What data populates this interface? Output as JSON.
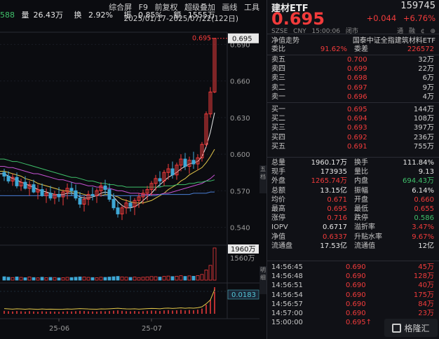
{
  "topbar": {
    "left_fragment": "588",
    "vol_label": "量",
    "vol": "26.43万",
    "turnover_label": "换",
    "turnover": "2.92%",
    "amplitude_label": "振",
    "amplitude": "0.85%",
    "amount_label": "额",
    "amount": "1555万",
    "menu": [
      "综合屏",
      "F9",
      "前复权",
      "超级叠加",
      "画线",
      "工具"
    ],
    "range": "2025/01/17-2025/07/22(122日)"
  },
  "chart_axes": {
    "price_ticks": [
      "0.690",
      "0.660",
      "0.630",
      "0.600",
      "0.570",
      "0.540"
    ],
    "last_price_tag": "0.695",
    "last_price_marker": "0.695",
    "volume_tag": "1960万",
    "volume_tick": "1560万",
    "indicator_tag": "0.0183",
    "date_labels": [
      "25-06",
      "25-07"
    ]
  },
  "chart_data": {
    "type": "candlestick",
    "title": "",
    "y_range": [
      0.53,
      0.7
    ],
    "candles": [
      [
        0.585,
        0.588,
        0.578,
        0.582
      ],
      [
        0.582,
        0.586,
        0.576,
        0.578
      ],
      [
        0.578,
        0.584,
        0.574,
        0.581
      ],
      [
        0.581,
        0.585,
        0.572,
        0.574
      ],
      [
        0.574,
        0.58,
        0.57,
        0.577
      ],
      [
        0.577,
        0.582,
        0.571,
        0.572
      ],
      [
        0.572,
        0.578,
        0.566,
        0.575
      ],
      [
        0.575,
        0.579,
        0.568,
        0.569
      ],
      [
        0.569,
        0.575,
        0.563,
        0.571
      ],
      [
        0.571,
        0.576,
        0.565,
        0.566
      ],
      [
        0.566,
        0.572,
        0.56,
        0.568
      ],
      [
        0.568,
        0.574,
        0.562,
        0.564
      ],
      [
        0.564,
        0.57,
        0.559,
        0.567
      ],
      [
        0.567,
        0.573,
        0.561,
        0.565
      ],
      [
        0.565,
        0.571,
        0.558,
        0.569
      ],
      [
        0.569,
        0.576,
        0.563,
        0.572
      ],
      [
        0.572,
        0.577,
        0.566,
        0.57
      ],
      [
        0.57,
        0.575,
        0.562,
        0.564
      ],
      [
        0.564,
        0.569,
        0.556,
        0.559
      ],
      [
        0.559,
        0.566,
        0.553,
        0.563
      ],
      [
        0.563,
        0.57,
        0.558,
        0.567
      ],
      [
        0.567,
        0.573,
        0.562,
        0.566
      ],
      [
        0.566,
        0.572,
        0.56,
        0.57
      ],
      [
        0.57,
        0.577,
        0.565,
        0.574
      ],
      [
        0.574,
        0.579,
        0.567,
        0.571
      ],
      [
        0.571,
        0.576,
        0.561,
        0.563
      ],
      [
        0.563,
        0.568,
        0.554,
        0.556
      ],
      [
        0.556,
        0.561,
        0.548,
        0.551
      ],
      [
        0.551,
        0.558,
        0.546,
        0.556
      ],
      [
        0.556,
        0.563,
        0.551,
        0.56
      ],
      [
        0.56,
        0.566,
        0.553,
        0.557
      ],
      [
        0.557,
        0.564,
        0.55,
        0.562
      ],
      [
        0.562,
        0.568,
        0.556,
        0.565
      ],
      [
        0.565,
        0.571,
        0.559,
        0.568
      ],
      [
        0.568,
        0.574,
        0.562,
        0.571
      ],
      [
        0.571,
        0.578,
        0.566,
        0.576
      ],
      [
        0.576,
        0.583,
        0.57,
        0.58
      ],
      [
        0.58,
        0.586,
        0.573,
        0.578
      ],
      [
        0.578,
        0.587,
        0.574,
        0.585
      ],
      [
        0.585,
        0.592,
        0.579,
        0.588
      ],
      [
        0.588,
        0.594,
        0.58,
        0.583
      ],
      [
        0.583,
        0.593,
        0.579,
        0.591
      ],
      [
        0.591,
        0.6,
        0.586,
        0.596
      ],
      [
        0.596,
        0.601,
        0.587,
        0.59
      ],
      [
        0.59,
        0.598,
        0.584,
        0.595
      ],
      [
        0.595,
        0.602,
        0.588,
        0.592
      ],
      [
        0.592,
        0.6,
        0.587,
        0.597
      ],
      [
        0.597,
        0.61,
        0.594,
        0.608
      ],
      [
        0.608,
        0.635,
        0.606,
        0.633
      ],
      [
        0.633,
        0.655,
        0.63,
        0.651
      ],
      [
        0.651,
        0.695,
        0.65,
        0.695
      ]
    ],
    "moving_averages": [
      {
        "color": "#e8e8e8",
        "values": [
          0.584,
          0.582,
          0.58,
          0.579,
          0.577,
          0.576,
          0.574,
          0.573,
          0.571,
          0.57,
          0.569,
          0.568,
          0.567,
          0.567,
          0.567,
          0.568,
          0.568,
          0.567,
          0.565,
          0.564,
          0.564,
          0.565,
          0.566,
          0.568,
          0.569,
          0.568,
          0.565,
          0.561,
          0.558,
          0.556,
          0.556,
          0.557,
          0.559,
          0.562,
          0.565,
          0.568,
          0.572,
          0.575,
          0.578,
          0.581,
          0.583,
          0.585,
          0.588,
          0.59,
          0.592,
          0.593,
          0.594,
          0.598,
          0.606,
          0.618,
          0.634
        ]
      },
      {
        "color": "#e3c74a",
        "values": [
          0.586,
          0.585,
          0.584,
          0.583,
          0.582,
          0.58,
          0.579,
          0.578,
          0.576,
          0.575,
          0.574,
          0.573,
          0.572,
          0.571,
          0.57,
          0.57,
          0.569,
          0.569,
          0.568,
          0.567,
          0.566,
          0.566,
          0.566,
          0.566,
          0.567,
          0.567,
          0.566,
          0.565,
          0.563,
          0.562,
          0.561,
          0.56,
          0.56,
          0.56,
          0.561,
          0.562,
          0.564,
          0.566,
          0.568,
          0.571,
          0.573,
          0.575,
          0.578,
          0.58,
          0.583,
          0.585,
          0.587,
          0.589,
          0.593,
          0.598,
          0.604
        ]
      },
      {
        "color": "#c653d3",
        "values": [
          0.59,
          0.589,
          0.589,
          0.588,
          0.587,
          0.586,
          0.585,
          0.584,
          0.584,
          0.583,
          0.582,
          0.581,
          0.58,
          0.579,
          0.579,
          0.578,
          0.577,
          0.576,
          0.576,
          0.575,
          0.574,
          0.574,
          0.573,
          0.573,
          0.572,
          0.572,
          0.571,
          0.57,
          0.57,
          0.569,
          0.568,
          0.568,
          0.568,
          0.567,
          0.567,
          0.567,
          0.567,
          0.567,
          0.568,
          0.568,
          0.569,
          0.57,
          0.571,
          0.572,
          0.573,
          0.574,
          0.575,
          0.576,
          0.578,
          0.58,
          0.583
        ]
      },
      {
        "color": "#3fc06a",
        "values": [
          0.596,
          0.595,
          0.594,
          0.594,
          0.593,
          0.592,
          0.591,
          0.59,
          0.589,
          0.588,
          0.587,
          0.586,
          0.585,
          0.584,
          0.583,
          0.582,
          0.581,
          0.581,
          0.58,
          0.579,
          0.578,
          0.578,
          0.577,
          0.576,
          0.576,
          0.575,
          0.575,
          0.574,
          0.574,
          0.573,
          0.573,
          0.573,
          0.573,
          0.573,
          0.573,
          0.573,
          0.573,
          0.573,
          0.574,
          0.574,
          0.574,
          0.575,
          0.575,
          0.575,
          0.576,
          0.576,
          0.577,
          0.577,
          0.578,
          0.578,
          0.579
        ]
      },
      {
        "color": "#4a7fd6",
        "values": [
          0.566,
          0.566,
          0.566,
          0.566,
          0.566,
          0.566,
          0.566,
          0.566,
          0.566,
          0.566,
          0.566,
          0.566,
          0.566,
          0.566,
          0.566,
          0.566,
          0.566,
          0.566,
          0.566,
          0.566,
          0.566,
          0.566,
          0.566,
          0.566,
          0.566,
          0.566,
          0.566,
          0.566,
          0.566,
          0.566,
          0.566,
          0.566,
          0.566,
          0.566,
          0.566,
          0.566,
          0.566,
          0.567,
          0.567,
          0.567,
          0.567,
          0.567,
          0.567,
          0.567,
          0.567,
          0.568,
          0.568,
          0.568,
          0.568,
          0.569,
          0.569
        ]
      }
    ],
    "volume": [
      210,
      180,
      160,
      200,
      170,
      150,
      190,
      160,
      140,
      180,
      150,
      170,
      160,
      140,
      150,
      170,
      160,
      180,
      200,
      190,
      170,
      160,
      150,
      180,
      170,
      190,
      210,
      230,
      200,
      180,
      170,
      190,
      160,
      180,
      200,
      220,
      210,
      190,
      230,
      250,
      220,
      240,
      270,
      230,
      260,
      240,
      280,
      350,
      620,
      900,
      1960
    ],
    "volume_ylim": [
      0,
      1960
    ],
    "indicator": [
      0.002,
      0.0018,
      0.0016,
      0.0019,
      0.0017,
      0.0015,
      0.0018,
      0.0016,
      0.0014,
      0.0017,
      0.0015,
      0.0016,
      0.0015,
      0.0014,
      0.0015,
      0.0017,
      0.0016,
      0.0018,
      0.002,
      0.0019,
      0.0017,
      0.0016,
      0.0015,
      0.0018,
      0.0017,
      0.0019,
      0.0021,
      0.0023,
      0.002,
      0.0018,
      0.0017,
      0.0019,
      0.0016,
      0.0018,
      0.002,
      0.0022,
      0.0021,
      0.0019,
      0.0023,
      0.0025,
      0.0022,
      0.0024,
      0.0027,
      0.0023,
      0.0026,
      0.0024,
      0.0028,
      0.0036,
      0.0062,
      0.0095,
      0.0183
    ],
    "indicator_ylim": [
      0,
      0.0183
    ]
  },
  "quote": {
    "name": "建材ETF",
    "code": "159745",
    "price": "0.695",
    "change": "+0.044",
    "change_pct": "+6.76%",
    "meta_left": [
      "SZSE",
      "CNY",
      "15:00:06",
      "闭市"
    ],
    "meta_right": [
      "通",
      "融",
      "¢",
      "⊕"
    ],
    "val_label": "净值走势",
    "fund_full_name": "国泰中证全指建筑材料ETF",
    "weibi_label": "委比",
    "weibi": "91.62%",
    "weicha_label": "委差",
    "weicha": "226572",
    "asks": [
      {
        "label": "卖五",
        "price": "0.700",
        "vol": "32万"
      },
      {
        "label": "卖四",
        "price": "0.699",
        "vol": "22万"
      },
      {
        "label": "卖三",
        "price": "0.698",
        "vol": "6万"
      },
      {
        "label": "卖二",
        "price": "0.697",
        "vol": "9万"
      },
      {
        "label": "卖一",
        "price": "0.696",
        "vol": "4万"
      }
    ],
    "bids": [
      {
        "label": "买一",
        "price": "0.695",
        "vol": "144万"
      },
      {
        "label": "买二",
        "price": "0.694",
        "vol": "108万"
      },
      {
        "label": "买三",
        "price": "0.693",
        "vol": "397万"
      },
      {
        "label": "买四",
        "price": "0.692",
        "vol": "236万"
      },
      {
        "label": "买五",
        "price": "0.691",
        "vol": "755万"
      }
    ],
    "stats": [
      {
        "k1": "总量",
        "v1": "1960.17万",
        "c1": "#e8e8e8",
        "k2": "换手",
        "v2": "111.84%",
        "c2": "#e8e8e8"
      },
      {
        "k1": "现手",
        "v1": "173935",
        "c1": "#e8e8e8",
        "k2": "量比",
        "v2": "9.13",
        "c2": "#e8e8e8"
      },
      {
        "k1": "外盘",
        "v1": "1265.74万",
        "c1": "#f23b3b",
        "k2": "内盘",
        "v2": "694.43万",
        "c2": "#3fc06a"
      },
      {
        "k1": "总额",
        "v1": "13.15亿",
        "c1": "#e8e8e8",
        "k2": "振幅",
        "v2": "6.14%",
        "c2": "#e8e8e8"
      },
      {
        "k1": "均价",
        "v1": "0.671",
        "c1": "#f23b3b",
        "k2": "开盘",
        "v2": "0.660",
        "c2": "#f23b3b"
      },
      {
        "k1": "最高",
        "v1": "0.695",
        "c1": "#f23b3b",
        "k2": "最低",
        "v2": "0.655",
        "c2": "#f23b3b"
      },
      {
        "k1": "涨停",
        "v1": "0.716",
        "c1": "#f23b3b",
        "k2": "跌停",
        "v2": "0.586",
        "c2": "#3fc06a"
      },
      {
        "k1": "IOPV",
        "v1": "0.6717",
        "c1": "#e8e8e8",
        "k2": "溢折率",
        "v2": "3.47%",
        "c2": "#f23b3b"
      },
      {
        "k1": "净值",
        "v1": "0.6337",
        "c1": "#f23b3b",
        "k2": "升贴水率",
        "v2": "9.67%",
        "c2": "#f23b3b"
      },
      {
        "k1": "流通盘",
        "v1": "17.53亿",
        "c1": "#e8e8e8",
        "k2": "流通值",
        "v2": "12亿",
        "c2": "#e8e8e8"
      }
    ],
    "ticks": [
      {
        "t": "14:56:45",
        "p": "0.690",
        "v": "45万"
      },
      {
        "t": "14:56:48",
        "p": "0.690",
        "v": "128万"
      },
      {
        "t": "14:56:51",
        "p": "0.690",
        "v": "40万"
      },
      {
        "t": "14:56:54",
        "p": "0.690",
        "v": "175万"
      },
      {
        "t": "14:56:57",
        "p": "0.690",
        "v": "84万"
      },
      {
        "t": "14:57:00",
        "p": "0.690",
        "v": "23万"
      },
      {
        "t": "15:00:00",
        "p": "0.695",
        "v": ""
      }
    ],
    "tick_arrow": "↑",
    "logo_text": "格隆汇"
  },
  "side_tabs": [
    "五",
    "档",
    "明",
    "细"
  ]
}
